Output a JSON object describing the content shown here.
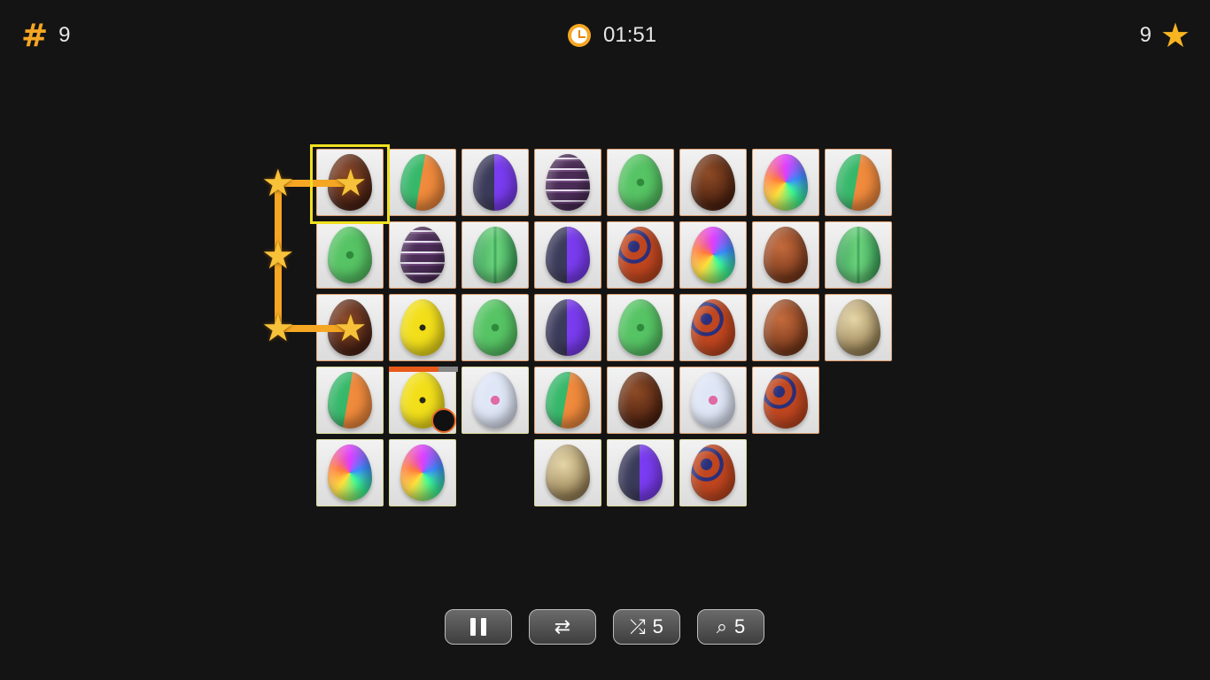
{
  "hud": {
    "level_icon": "hash-icon",
    "level": "9",
    "timer_icon": "clock-icon",
    "time": "01:51",
    "stars": "9",
    "stars_icon": "star-icon"
  },
  "board": {
    "rows": [
      [
        "chocolate",
        "green-orange",
        "purple-split",
        "folk-purple",
        "green-floral",
        "bow",
        "rainbow",
        "green-orange"
      ],
      [
        "green-floral",
        "folk-purple",
        "green-stripe",
        "purple-split",
        "spiral",
        "rainbow",
        "chick",
        "green-stripe"
      ],
      [
        "chocolate",
        "yellow-folk",
        "green-floral",
        "purple-split",
        "green-floral",
        "spiral",
        "chick",
        "gold"
      ],
      [
        "green-orange",
        "yellow-folk",
        "blue-floral",
        "green-orange",
        "bow",
        "blue-floral",
        "spiral"
      ],
      [
        "rainbow",
        "rainbow",
        "",
        "gold",
        "purple-split",
        "spiral"
      ]
    ],
    "selected_tiles": [
      "row1-col1",
      "row3-col1"
    ],
    "bomb_tile": "row4-col2",
    "bomb_timer_remaining": 0.72
  },
  "toolbar": {
    "pause_icon": "pause-icon",
    "swap_icon": "swap-icon",
    "shuffle_icon": "shuffle-icon",
    "shuffle_count": "5",
    "hint_icon": "magnifier-icon",
    "hint_count": "5"
  },
  "colors": {
    "background": "#141414",
    "accent": "#f5a623",
    "selection": "#f0e020",
    "bomb_timer": "#e85a1a"
  }
}
